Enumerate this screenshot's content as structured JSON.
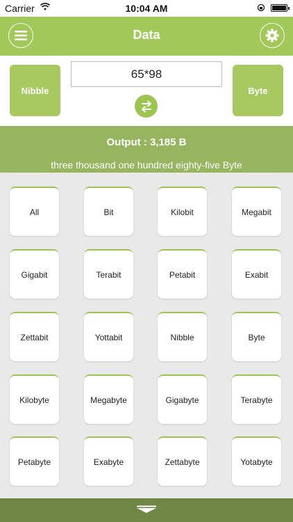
{
  "status_bar": {
    "carrier": "Carrier",
    "time": "10:04 AM"
  },
  "header": {
    "title": "Data"
  },
  "converter": {
    "from_unit": "Nibble",
    "to_unit": "Byte",
    "expression": "65*98"
  },
  "output": {
    "result": "Output : 3,185 B",
    "words": "three thousand one hundred eighty-five Byte"
  },
  "units": [
    "All",
    "Bit",
    "Kilobit",
    "Megabit",
    "Gigabit",
    "Terabit",
    "Petabit",
    "Exabit",
    "Zettabit",
    "Yottabit",
    "Nibble",
    "Byte",
    "Kilobyte",
    "Megabyte",
    "Gigabyte",
    "Terabyte",
    "Petabyte",
    "Exabyte",
    "Zettabyte",
    "Yotabyte"
  ],
  "colors": {
    "accent_green": "#a2c85a",
    "output_green": "#97b45f",
    "bottom_bar": "#6e8744"
  },
  "icons": {
    "menu": "menu-icon",
    "settings": "gear-icon",
    "swap": "swap-arrows-icon",
    "handle": "collapse-handle-icon"
  }
}
